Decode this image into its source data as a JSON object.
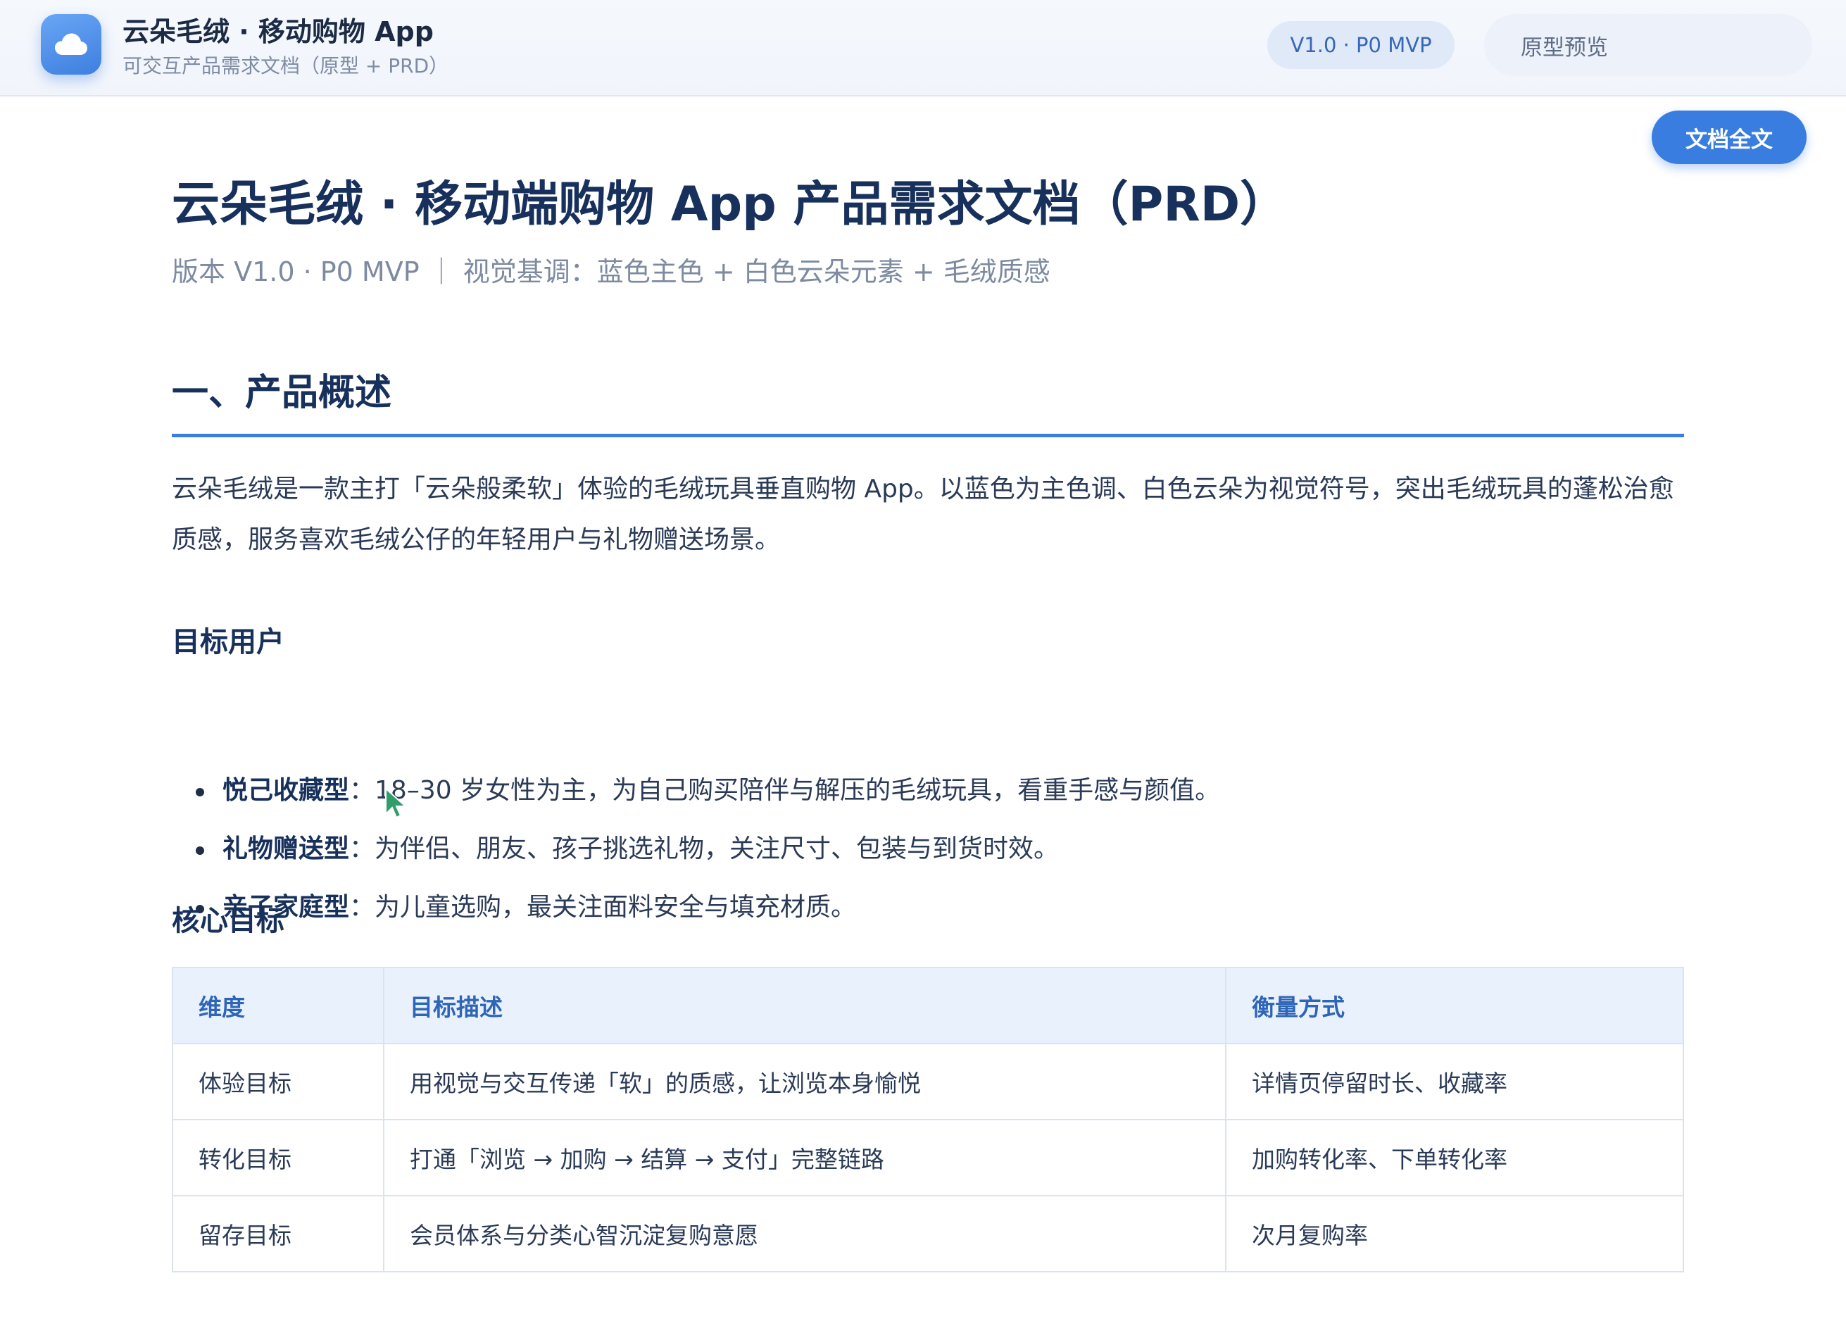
{
  "header": {
    "logo_icon": "cloud-icon",
    "app_title": "云朵毛绒 · 移动购物 App",
    "app_subtitle": "可交互产品需求文档（原型 + PRD）",
    "version_badge": "V1.0 · P0 MVP",
    "nav": {
      "preview_label": "原型预览",
      "doc_label": "文档全文",
      "active": "文档全文"
    },
    "accent_color": "#3a7de0"
  },
  "document": {
    "title": "云朵毛绒 · 移动端购物 App 产品需求文档（PRD）",
    "meta": "版本 V1.0 · P0 MVP ｜ 视觉基调：蓝色主色 + 白色云朵元素 + 毛绒质感",
    "section1": {
      "heading": "一、产品概述",
      "intro": "云朵毛绒是一款主打「云朵般柔软」体验的毛绒玩具垂直购物 App。以蓝色为主色调、白色云朵为视觉符号，突出毛绒玩具的蓬松治愈质感，服务喜欢毛绒公仔的年轻用户与礼物赠送场景。",
      "target_users": {
        "heading": "目标用户",
        "items": [
          {
            "name": "悦己收藏型",
            "desc": "：18–30 岁女性为主，为自己购买陪伴与解压的毛绒玩具，看重手感与颜值。"
          },
          {
            "name": "礼物赠送型",
            "desc": "：为伴侣、朋友、孩子挑选礼物，关注尺寸、包装与到货时效。"
          },
          {
            "name": "亲子家庭型",
            "desc": "：为儿童选购，最关注面料安全与填充材质。"
          }
        ]
      },
      "core_goals": {
        "heading": "核心目标",
        "columns": [
          "维度",
          "目标描述",
          "衡量方式"
        ],
        "rows": [
          [
            "体验目标",
            "用视觉与交互传递「软」的质感，让浏览本身愉悦",
            "详情页停留时长、收藏率"
          ],
          [
            "转化目标",
            "打通「浏览 → 加购 → 结算 → 支付」完整链路",
            "加购转化率、下单转化率"
          ],
          [
            "留存目标",
            "会员体系与分类心智沉淀复购意愿",
            "次月复购率"
          ]
        ]
      }
    }
  }
}
